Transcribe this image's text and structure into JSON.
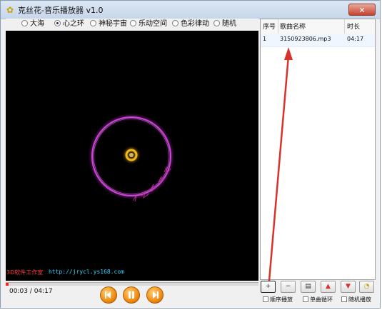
{
  "window": {
    "title": "克丝花-音乐播放器 v1.0",
    "close_glyph": "✕"
  },
  "modes": [
    {
      "label": "大海",
      "selected": false
    },
    {
      "label": "心之环",
      "selected": true
    },
    {
      "label": "神秘宇宙",
      "selected": false
    },
    {
      "label": "乐动空间",
      "selected": false
    },
    {
      "label": "色彩律动",
      "selected": false
    },
    {
      "label": "随机",
      "selected": false
    }
  ],
  "visualizer": {
    "background": "#000000",
    "ring_color": "#d23fe0",
    "core_color": "#f3b51b",
    "studio_label": "3D软件工作室",
    "studio_url": "http://jrycl.ys168.com"
  },
  "playback": {
    "time_readout": "00:03 / 04:17",
    "progress": 0.012,
    "progress_color": "#ff2020"
  },
  "controls": {
    "prev_icon": "previous-icon",
    "pause_icon": "pause-icon",
    "next_icon": "next-icon"
  },
  "playlist": {
    "headers": {
      "index": "序号",
      "name": "歌曲名称",
      "duration": "时长"
    },
    "rows": [
      {
        "index": "1",
        "name": "3150923806.mp3",
        "duration": "04:17"
      }
    ]
  },
  "toolbar": {
    "buttons": [
      {
        "name": "add-icon",
        "glyph": "+"
      },
      {
        "name": "remove-icon",
        "glyph": "−"
      },
      {
        "name": "clear-icon",
        "glyph": "▤"
      },
      {
        "name": "move-up-icon",
        "glyph": "▲"
      },
      {
        "name": "move-down-icon",
        "glyph": "▼"
      },
      {
        "name": "save-list-icon",
        "glyph": "◔"
      }
    ]
  },
  "options": [
    {
      "label": "顺序播放"
    },
    {
      "label": "单曲循环"
    },
    {
      "label": "随机播放"
    }
  ],
  "annotation": {
    "arrow_color": "#d8322a"
  }
}
